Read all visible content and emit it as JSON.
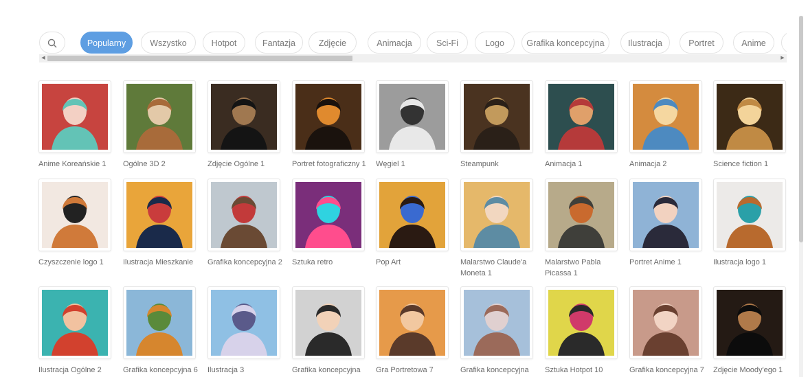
{
  "categories": [
    "Popularny",
    "Wszystko",
    "Hotpot",
    "Fantazja",
    "Zdjęcie",
    "Animacja",
    "Sci-Fi",
    "Logo",
    "Grafika koncepcyjna",
    "Ilustracja",
    "Portret",
    "Anime"
  ],
  "active_category": "Popularny",
  "items": [
    {
      "label": "Anime Koreańskie 1",
      "bg": "#c7443f",
      "fg": "#63c3b6",
      "accent": "#f3d0c4"
    },
    {
      "label": "Ogólne 3D 2",
      "bg": "#5f7a3a",
      "fg": "#a86b3a",
      "accent": "#e3c9a8"
    },
    {
      "label": "Zdjęcie Ogólne 1",
      "bg": "#3a2c21",
      "fg": "#141414",
      "accent": "#a07850"
    },
    {
      "label": "Portret fotograficzny 1",
      "bg": "#4a2e18",
      "fg": "#1a120d",
      "accent": "#e08a2e"
    },
    {
      "label": "Węgiel 1",
      "bg": "#9c9c9c",
      "fg": "#e8e8e8",
      "accent": "#333333"
    },
    {
      "label": "Steampunk",
      "bg": "#4a3320",
      "fg": "#2a2018",
      "accent": "#c29a5c"
    },
    {
      "label": "Animacja 1",
      "bg": "#2d4e4f",
      "fg": "#b53a3a",
      "accent": "#e0a06a"
    },
    {
      "label": "Animacja 2",
      "bg": "#d48b3e",
      "fg": "#4d8ac0",
      "accent": "#f5d7a0"
    },
    {
      "label": "Science fiction 1",
      "bg": "#3c2a16",
      "fg": "#c08a44",
      "accent": "#f3d49a"
    },
    {
      "label": "Czyszczenie logo 1",
      "bg": "#f2e8e1",
      "fg": "#d07a3a",
      "accent": "#222222"
    },
    {
      "label": "Ilustracja Mieszkanie",
      "bg": "#e9a53a",
      "fg": "#1a2a4a",
      "accent": "#c93c3c"
    },
    {
      "label": "Grafika koncepcyjna 2",
      "bg": "#bfc8cf",
      "fg": "#6a4a34",
      "accent": "#c23a3a"
    },
    {
      "label": "Sztuka retro",
      "bg": "#7a2e7a",
      "fg": "#ff4d8d",
      "accent": "#2fd3e0"
    },
    {
      "label": "Pop Art",
      "bg": "#e2a33a",
      "fg": "#2a1a12",
      "accent": "#3a6ad0"
    },
    {
      "label": "Malarstwo Claude'a Moneta 1",
      "bg": "#e5b86a",
      "fg": "#5d8ca3",
      "accent": "#f2d7c0"
    },
    {
      "label": "Malarstwo Pabla Picassa 1",
      "bg": "#b7aa8a",
      "fg": "#3f3f3a",
      "accent": "#c96a2e"
    },
    {
      "label": "Portret Anime 1",
      "bg": "#8fb3d6",
      "fg": "#2a2a3a",
      "accent": "#f2d2c0"
    },
    {
      "label": "Ilustracja logo 1",
      "bg": "#eceae8",
      "fg": "#b86a2e",
      "accent": "#2aa0a8"
    },
    {
      "label": "Ilustracja Ogólne 2",
      "bg": "#3bb3b0",
      "fg": "#d2412e",
      "accent": "#f2c2a0"
    },
    {
      "label": "Grafika koncepcyjna 6",
      "bg": "#8bb7d8",
      "fg": "#d6862e",
      "accent": "#5a8a3a"
    },
    {
      "label": "Ilustracja 3",
      "bg": "#8fc0e4",
      "fg": "#d7d2ea",
      "accent": "#5a5a8a"
    },
    {
      "label": "Grafika koncepcyjna",
      "bg": "#d2d2d2",
      "fg": "#2a2a2a",
      "accent": "#f2d2b8"
    },
    {
      "label": "Gra Portretowa 7",
      "bg": "#e69a4a",
      "fg": "#5a3a2a",
      "accent": "#f2c8a0"
    },
    {
      "label": "Grafika koncepcyjna",
      "bg": "#a6c0da",
      "fg": "#9b6a5a",
      "accent": "#e0d0d0"
    },
    {
      "label": "Sztuka Hotpot 10",
      "bg": "#e0d64a",
      "fg": "#2a2a2a",
      "accent": "#d03a6a"
    },
    {
      "label": "Grafika koncepcyjna 7",
      "bg": "#c89a8a",
      "fg": "#6a4030",
      "accent": "#f2d4c4"
    },
    {
      "label": "Zdjęcie Moody'ego 1",
      "bg": "#241a14",
      "fg": "#0c0c0c",
      "accent": "#b07a4a"
    }
  ]
}
